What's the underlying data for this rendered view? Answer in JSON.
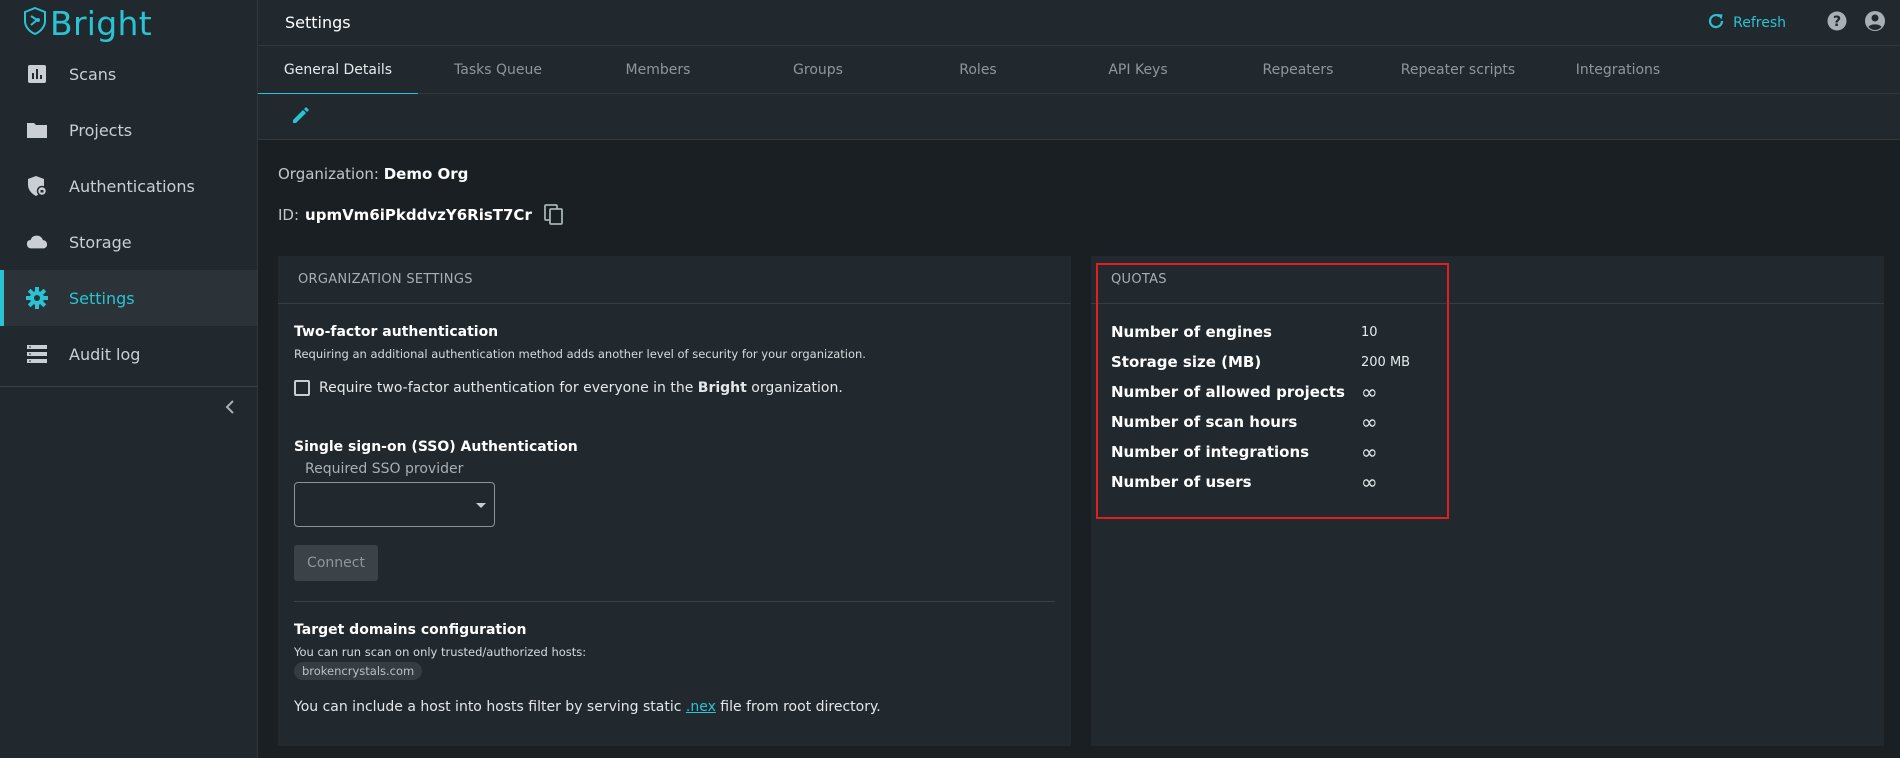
{
  "app": {
    "logo_text": "Bright",
    "brand_color": "#2ac3d4"
  },
  "sidebar": {
    "items": [
      {
        "label": "Scans",
        "icon": "bar-chart-icon"
      },
      {
        "label": "Projects",
        "icon": "folder-icon"
      },
      {
        "label": "Authentications",
        "icon": "shield-lock-icon"
      },
      {
        "label": "Storage",
        "icon": "cloud-icon"
      },
      {
        "label": "Settings",
        "icon": "gear-icon",
        "active": true
      },
      {
        "label": "Audit log",
        "icon": "list-icon"
      }
    ]
  },
  "header": {
    "title": "Settings",
    "refresh_label": "Refresh"
  },
  "tabs": [
    {
      "label": "General Details",
      "active": true
    },
    {
      "label": "Tasks Queue"
    },
    {
      "label": "Members"
    },
    {
      "label": "Groups"
    },
    {
      "label": "Roles"
    },
    {
      "label": "API Keys"
    },
    {
      "label": "Repeaters"
    },
    {
      "label": "Repeater scripts"
    },
    {
      "label": "Integrations"
    }
  ],
  "org": {
    "org_label": "Organization:",
    "org_name": "Demo Org",
    "id_label": "ID:",
    "id_value": "upmVm6iPkddvzY6RisT7Cr"
  },
  "org_settings": {
    "header": "ORGANIZATION SETTINGS",
    "twofa_title": "Two-factor authentication",
    "twofa_desc": "Requiring an additional authentication method adds another level of security for your organization.",
    "twofa_checkbox_prefix": "Require two-factor authentication for everyone in the ",
    "twofa_checkbox_brand": "Bright",
    "twofa_checkbox_suffix": " organization.",
    "sso_title": "Single sign-on (SSO) Authentication",
    "sso_select_label": "Required SSO provider",
    "sso_select_value": "",
    "connect_label": "Connect",
    "target_title": "Target domains configuration",
    "target_desc": "You can run scan on only trusted/authorized hosts:",
    "target_host": "brokencrystals.com",
    "nex_prefix": "You can include a host into hosts filter by serving static ",
    "nex_link": ".nex",
    "nex_suffix": " file from root directory."
  },
  "quotas": {
    "header": "QUOTAS",
    "rows": [
      {
        "label": "Number of engines",
        "value": "10"
      },
      {
        "label": "Storage size (MB)",
        "value": "200 MB"
      },
      {
        "label": "Number of allowed projects",
        "value": "∞"
      },
      {
        "label": "Number of scan hours",
        "value": "∞"
      },
      {
        "label": "Number of integrations",
        "value": "∞"
      },
      {
        "label": "Number of users",
        "value": "∞"
      }
    ],
    "highlight_color": "#e02020"
  }
}
